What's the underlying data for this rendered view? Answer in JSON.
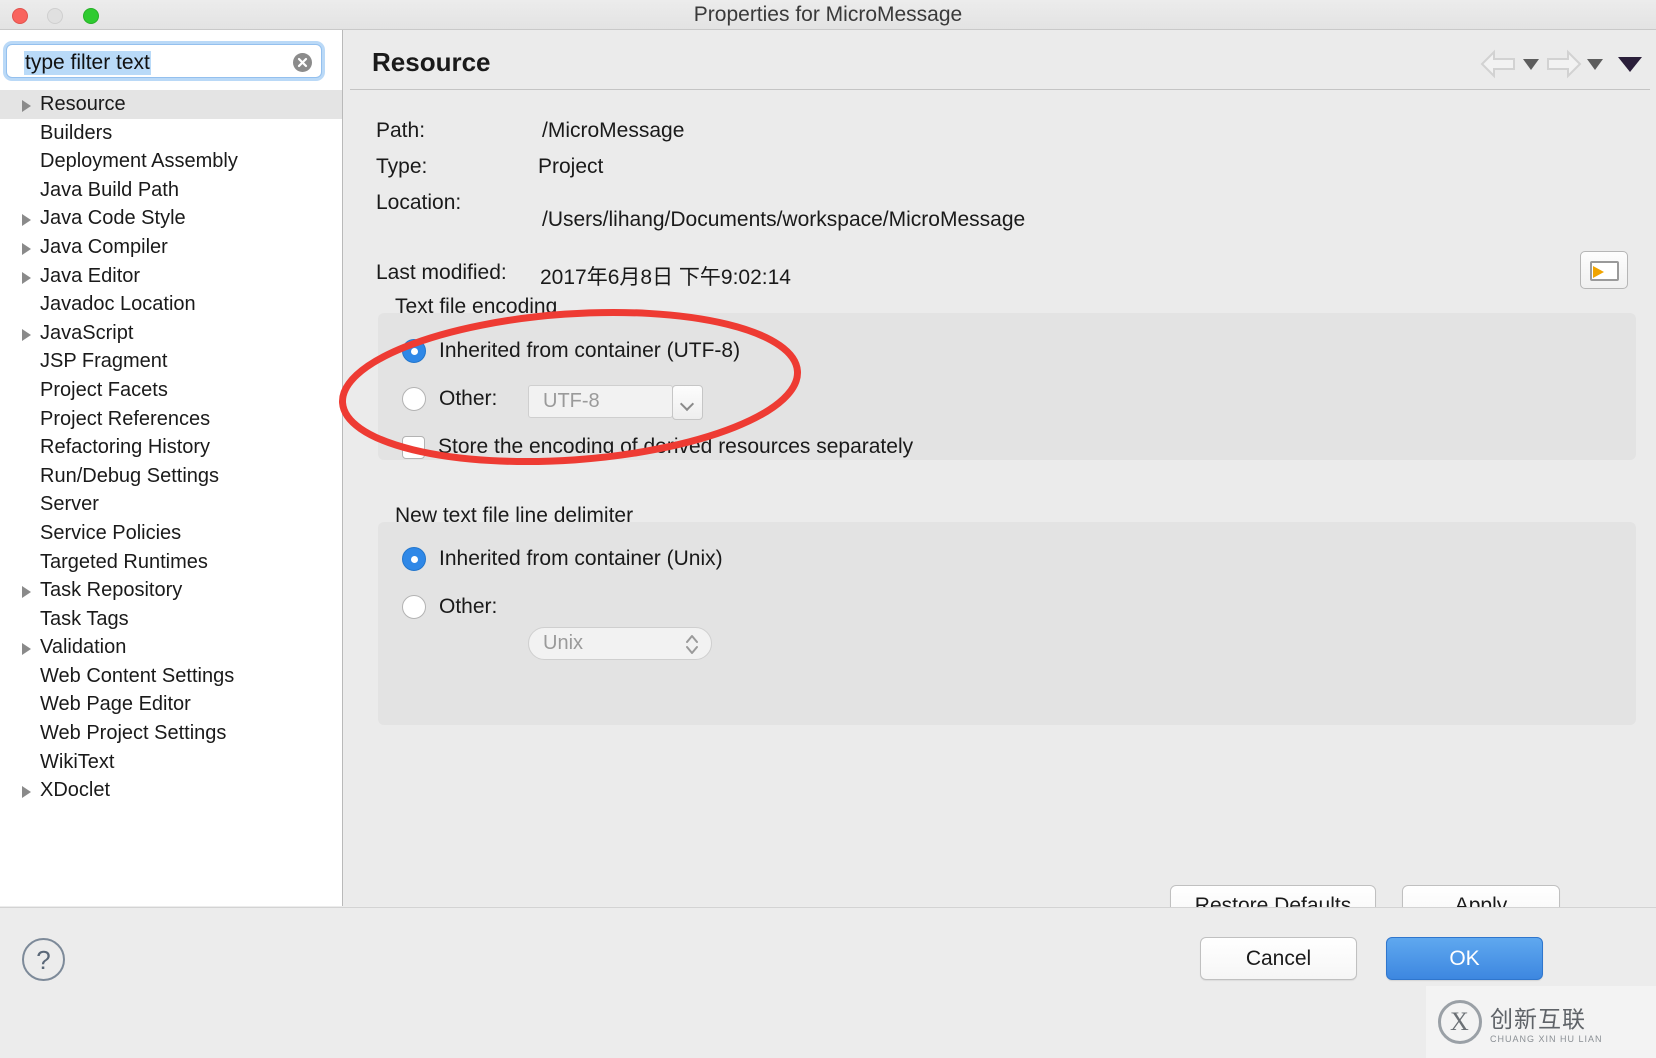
{
  "window": {
    "title": "Properties for MicroMessage",
    "traffic_lights": [
      "close",
      "minimize",
      "zoom"
    ],
    "colors": {
      "close": "#f9635d",
      "minimize": "#e0e0e0",
      "zoom": "#2ecb30",
      "accent_blue": "#2f88e7",
      "annotation_red": "#ee3b33",
      "selection_blue": "#b9daf8"
    }
  },
  "filter": {
    "value": "type filter text",
    "placeholder": "type filter text",
    "clear_icon": "clear-circle-icon"
  },
  "tree": {
    "selected": "Resource",
    "items": [
      {
        "label": "Resource",
        "expandable": true,
        "selected": true
      },
      {
        "label": "Builders",
        "expandable": false,
        "selected": false
      },
      {
        "label": "Deployment Assembly",
        "expandable": false,
        "selected": false
      },
      {
        "label": "Java Build Path",
        "expandable": false,
        "selected": false
      },
      {
        "label": "Java Code Style",
        "expandable": true,
        "selected": false
      },
      {
        "label": "Java Compiler",
        "expandable": true,
        "selected": false
      },
      {
        "label": "Java Editor",
        "expandable": true,
        "selected": false
      },
      {
        "label": "Javadoc Location",
        "expandable": false,
        "selected": false
      },
      {
        "label": "JavaScript",
        "expandable": true,
        "selected": false
      },
      {
        "label": "JSP Fragment",
        "expandable": false,
        "selected": false
      },
      {
        "label": "Project Facets",
        "expandable": false,
        "selected": false
      },
      {
        "label": "Project References",
        "expandable": false,
        "selected": false
      },
      {
        "label": "Refactoring History",
        "expandable": false,
        "selected": false
      },
      {
        "label": "Run/Debug Settings",
        "expandable": false,
        "selected": false
      },
      {
        "label": "Server",
        "expandable": false,
        "selected": false
      },
      {
        "label": "Service Policies",
        "expandable": false,
        "selected": false
      },
      {
        "label": "Targeted Runtimes",
        "expandable": false,
        "selected": false
      },
      {
        "label": "Task Repository",
        "expandable": true,
        "selected": false
      },
      {
        "label": "Task Tags",
        "expandable": false,
        "selected": false
      },
      {
        "label": "Validation",
        "expandable": true,
        "selected": false
      },
      {
        "label": "Web Content Settings",
        "expandable": false,
        "selected": false
      },
      {
        "label": "Web Page Editor",
        "expandable": false,
        "selected": false
      },
      {
        "label": "Web Project Settings",
        "expandable": false,
        "selected": false
      },
      {
        "label": "WikiText",
        "expandable": false,
        "selected": false
      },
      {
        "label": "XDoclet",
        "expandable": true,
        "selected": false
      }
    ]
  },
  "page": {
    "title": "Resource",
    "nav": {
      "back_icon": "arrow-left-icon",
      "back_menu_icon": "chevron-down-icon",
      "forward_icon": "arrow-right-icon",
      "forward_menu_icon": "chevron-down-icon",
      "menu_icon": "triangle-down-icon"
    },
    "fields": {
      "path_label": "Path:",
      "path_value": "/MicroMessage",
      "type_label": "Type:",
      "type_value": "Project",
      "location_label": "Location:",
      "location_value": "/Users/lihang/Documents/workspace/MicroMessage",
      "browse_icon": "folder-arrow-icon",
      "modified_label": "Last modified:",
      "modified_value": "2017年6月8日 下午9:02:14"
    },
    "encoding_group": {
      "label": "Text file encoding",
      "inherit_label": "Inherited from container (UTF-8)",
      "inherit_selected": true,
      "other_label": "Other:",
      "other_selected": false,
      "other_value": "UTF-8",
      "other_disabled": true,
      "other_dropdown_icon": "chevron-down-icon",
      "store_checkbox_label": "Store the encoding of derived resources separately",
      "store_checked": false
    },
    "delimiter_group": {
      "label": "New text file line delimiter",
      "inherit_label": "Inherited from container (Unix)",
      "inherit_selected": true,
      "other_label": "Other:",
      "other_selected": false,
      "other_value": "Unix",
      "other_disabled": true,
      "other_stepper_icon": "stepper-updown-icon"
    },
    "buttons": {
      "restore_defaults": "Restore Defaults",
      "apply": "Apply"
    }
  },
  "bottom": {
    "help_label": "?",
    "help_icon": "help-circle-icon",
    "cancel": "Cancel",
    "ok": "OK"
  },
  "annotation": {
    "shape": "ellipse",
    "color": "#ee3b33",
    "targets": [
      "encoding-inherit-radio",
      "encoding-other-radio"
    ]
  },
  "watermark": {
    "logo_icon": "cx-logo-icon",
    "line1": "创新互联",
    "line2": "CHUANG XIN HU LIAN"
  }
}
